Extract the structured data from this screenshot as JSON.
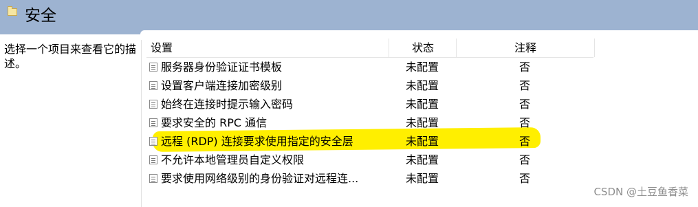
{
  "window": {
    "title": "安全"
  },
  "description_pane": {
    "text": "选择一个项目来查看它的描述。"
  },
  "table": {
    "columns": [
      "设置",
      "状态",
      "注释"
    ],
    "rows": [
      {
        "setting": "服务器身份验证证书模板",
        "state": "未配置",
        "comment": "否"
      },
      {
        "setting": "设置客户端连接加密级别",
        "state": "未配置",
        "comment": "否"
      },
      {
        "setting": "始终在连接时提示输入密码",
        "state": "未配置",
        "comment": "否"
      },
      {
        "setting": "要求安全的 RPC 通信",
        "state": "未配置",
        "comment": "否"
      },
      {
        "setting": "远程 (RDP) 连接要求使用指定的安全层",
        "state": "未配置",
        "comment": "否",
        "highlighted": true
      },
      {
        "setting": "不允许本地管理员自定义权限",
        "state": "未配置",
        "comment": "否"
      },
      {
        "setting": "要求使用网络级别的身份验证对远程连...",
        "state": "未配置",
        "comment": "否"
      }
    ]
  },
  "watermark": "CSDN @土豆鱼香菜",
  "colors": {
    "header": "#9db3d1",
    "highlight": "#ffef00"
  }
}
